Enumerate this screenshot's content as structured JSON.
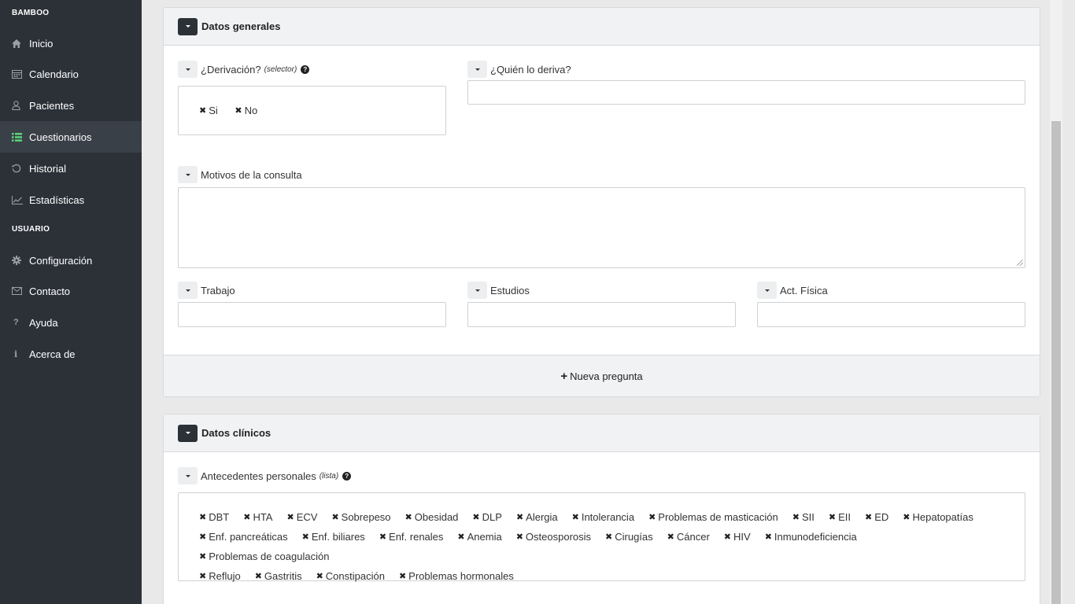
{
  "sidebar": {
    "sections": [
      {
        "title": "BAMBOO",
        "items": [
          {
            "label": "Inicio",
            "icon": "home-icon"
          },
          {
            "label": "Calendario",
            "icon": "calendar-icon"
          },
          {
            "label": "Pacientes",
            "icon": "user-icon"
          },
          {
            "label": "Cuestionarios",
            "icon": "list-icon",
            "active": true
          },
          {
            "label": "Historial",
            "icon": "history-icon"
          },
          {
            "label": "Estadísticas",
            "icon": "line-chart-icon"
          }
        ]
      },
      {
        "title": "USUARIO",
        "items": [
          {
            "label": "Configuración",
            "icon": "gear-icon"
          },
          {
            "label": "Contacto",
            "icon": "envelope-icon"
          },
          {
            "label": "Ayuda",
            "icon": "question-icon"
          },
          {
            "label": "Acerca de",
            "icon": "info-icon"
          }
        ]
      }
    ]
  },
  "general": {
    "title": "Datos generales",
    "derivacion": {
      "label": "¿Derivación?",
      "hint": "(selector)",
      "options": [
        "Si",
        "No"
      ]
    },
    "quien": {
      "label": "¿Quién lo deriva?",
      "value": ""
    },
    "motivos": {
      "label": "Motivos de la consulta",
      "value": ""
    },
    "trabajo": {
      "label": "Trabajo",
      "value": ""
    },
    "estudios": {
      "label": "Estudios",
      "value": ""
    },
    "actividad": {
      "label": "Act. Física",
      "value": ""
    },
    "new_question": "Nueva pregunta"
  },
  "clinical": {
    "title": "Datos clínicos",
    "antecedentes": {
      "label": "Antecedentes personales",
      "hint": "(lista)",
      "rows": [
        [
          "DBT",
          "HTA",
          "ECV",
          "Sobrepeso",
          "Obesidad",
          "DLP",
          "Alergia",
          "Intolerancia",
          "Problemas de masticación",
          "SII",
          "EII",
          "ED",
          "Hepatopatías"
        ],
        [
          "Enf. pancreáticas",
          "Enf. biliares",
          "Enf. renales",
          "Anemia",
          "Osteosporosis",
          "Cirugías",
          "Cáncer",
          "HIV",
          "Inmunodeficiencia",
          "Problemas de coagulación"
        ],
        [
          "Reflujo",
          "Gastritis",
          "Constipación",
          "Problemas hormonales"
        ]
      ]
    }
  }
}
